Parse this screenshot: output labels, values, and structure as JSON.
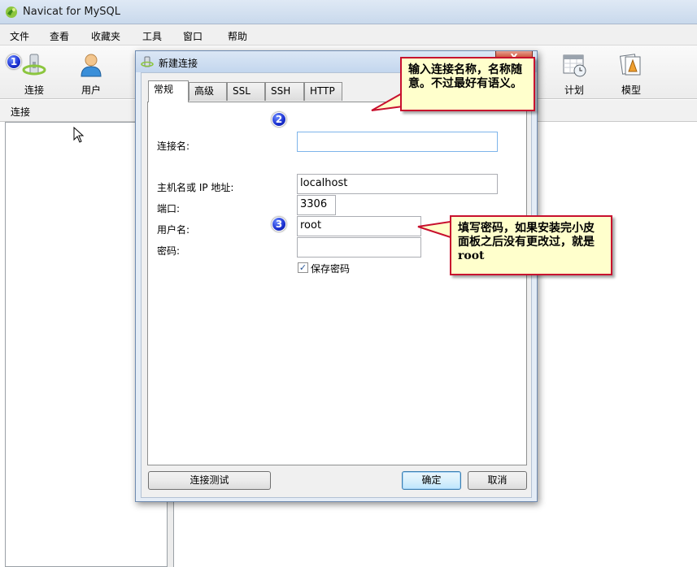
{
  "window": {
    "title": "Navicat for MySQL"
  },
  "menu": [
    "文件",
    "查看",
    "收藏夹",
    "工具",
    "窗口",
    "帮助"
  ],
  "toolbar": {
    "connect": "连接",
    "user": "用户",
    "schedule": "计划",
    "model": "模型"
  },
  "nav_header": "连接",
  "dialog": {
    "title": "新建连接",
    "close": "X",
    "tabs": [
      "常规",
      "高级",
      "SSL",
      "SSH",
      "HTTP"
    ],
    "fields": {
      "conn_name_label": "连接名:",
      "conn_name_value": "",
      "host_label": "主机名或 IP 地址:",
      "host_value": "localhost",
      "port_label": "端口:",
      "port_value": "3306",
      "user_label": "用户名:",
      "user_value": "root",
      "password_label": "密码:",
      "password_value": "",
      "save_password": "保存密码",
      "save_password_checked": "✓"
    },
    "buttons": {
      "test": "连接测试",
      "ok": "确定",
      "cancel": "取消"
    }
  },
  "badges": [
    "1",
    "2",
    "3"
  ],
  "callouts": {
    "name_hint": "输入连接名称，名称随意。不过最好有语义。",
    "password_hint": "填写密码，如果安装完小皮面板之后没有更改过，就是root"
  },
  "colors": {
    "callout_bg": "#ffffcc",
    "callout_border": "#c8102e",
    "badge": "#1a2fd0"
  }
}
